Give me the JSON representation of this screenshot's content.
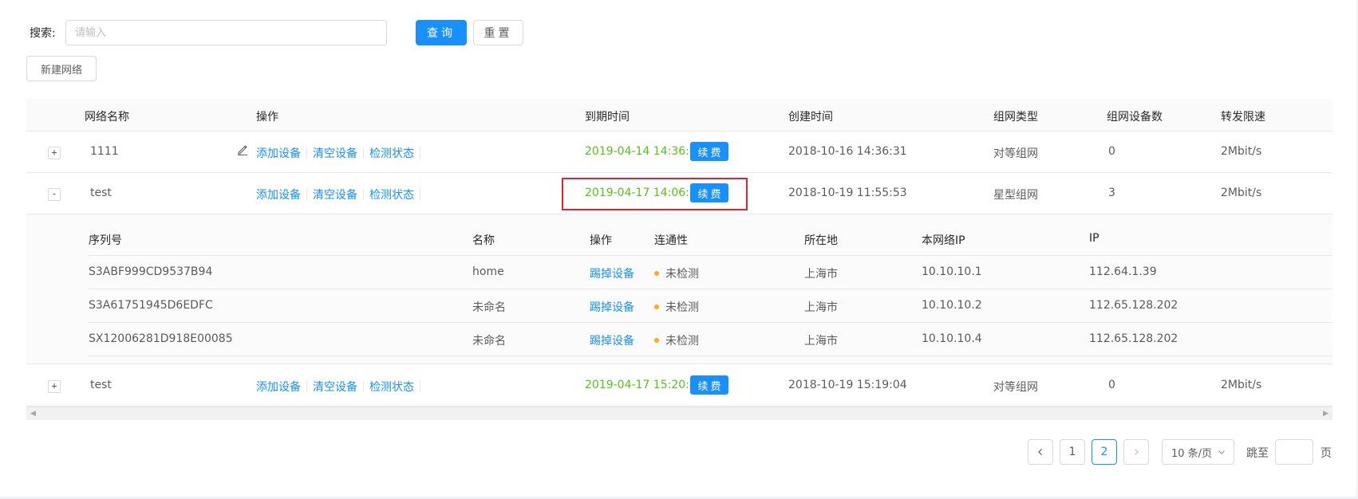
{
  "search": {
    "label": "搜索:",
    "placeholder": "请输入",
    "query_label": "查询",
    "reset_label": "重置"
  },
  "toolbar": {
    "new_network_label": "新建网络"
  },
  "table": {
    "columns": [
      "网络名称",
      "操作",
      "到期时间",
      "创建时间",
      "组网类型",
      "组网设备数",
      "转发限速"
    ],
    "action_labels": [
      "添加设备",
      "清空设备",
      "检测状态"
    ],
    "renew_label": "续费",
    "rows": [
      {
        "expand": "+",
        "name": "1111",
        "expire": "2019-04-14 14:36:43",
        "created": "2018-10-16 14:36:31",
        "type": "对等组网",
        "device_count": "0",
        "speed": "2Mbit/s"
      },
      {
        "expand": "-",
        "name": "test",
        "expire": "2019-04-17 14:06:50",
        "created": "2018-10-19 11:55:53",
        "type": "星型组网",
        "device_count": "3",
        "speed": "2Mbit/s"
      },
      {
        "expand": "+",
        "name": "test",
        "expire": "2019-04-17 15:20:48",
        "created": "2018-10-19 15:19:04",
        "type": "对等组网",
        "device_count": "0",
        "speed": "2Mbit/s"
      }
    ],
    "sub_table": {
      "columns": [
        "序列号",
        "名称",
        "操作",
        "连通性",
        "所在地",
        "本网络IP",
        "IP"
      ],
      "kick_label": "踢掉设备",
      "rows": [
        {
          "serial": "S3ABF999CD9537B94",
          "name": "home",
          "status": "未检测",
          "location": "上海市",
          "net_ip": "10.10.10.1",
          "ip": "112.64.1.39"
        },
        {
          "serial": "S3A61751945D6EDFC",
          "name": "未命名",
          "status": "未检测",
          "location": "上海市",
          "net_ip": "10.10.10.2",
          "ip": "112.65.128.202"
        },
        {
          "serial": "SX12006281D918E00085",
          "name": "未命名",
          "status": "未检测",
          "location": "上海市",
          "net_ip": "10.10.10.4",
          "ip": "112.65.128.202"
        }
      ]
    }
  },
  "pagination": {
    "pages": [
      "1",
      "2"
    ],
    "current": "2",
    "page_size_label": "10 条/页",
    "jump_label": "跳至",
    "page_suffix": "页"
  },
  "colors": {
    "primary": "#1890ff",
    "expire_green": "#52c41a",
    "status_dot": "#faad14",
    "highlight_red": "#e8202a"
  }
}
